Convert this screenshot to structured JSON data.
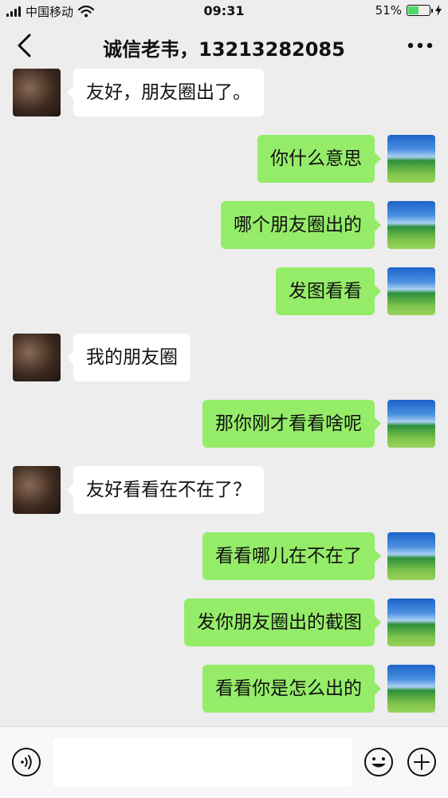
{
  "status_bar": {
    "carrier": "中国移动",
    "time": "09:31",
    "battery": "51%",
    "battery_level": 0.51
  },
  "header": {
    "title": "诚信老韦，13213282085"
  },
  "messages": [
    {
      "side": "left",
      "text": "友好，朋友圈出了。"
    },
    {
      "side": "right",
      "text": "你什么意思"
    },
    {
      "side": "right",
      "text": "哪个朋友圈出的"
    },
    {
      "side": "right",
      "text": "发图看看"
    },
    {
      "side": "left",
      "text": "我的朋友圈"
    },
    {
      "side": "right",
      "text": "那你刚才看看啥呢"
    },
    {
      "side": "left",
      "text": "友好看看在不在了？"
    },
    {
      "side": "right",
      "text": "看看哪儿在不在了"
    },
    {
      "side": "right",
      "text": "发你朋友圈出的截图"
    },
    {
      "side": "right",
      "text": "看看你是怎么出的"
    }
  ],
  "input": {
    "value": "",
    "placeholder": ""
  },
  "icons": {
    "back": "chevron-left-icon",
    "more": "more-dots-icon",
    "voice": "voice-icon",
    "emoji": "emoji-icon",
    "plus": "plus-icon",
    "wifi": "wifi-icon",
    "signal": "signal-icon",
    "battery": "battery-icon",
    "charging": "charging-icon"
  },
  "colors": {
    "background": "#ededed",
    "sent_bubble": "#95ec69",
    "received_bubble": "#ffffff",
    "battery_fill": "#4cd964"
  }
}
